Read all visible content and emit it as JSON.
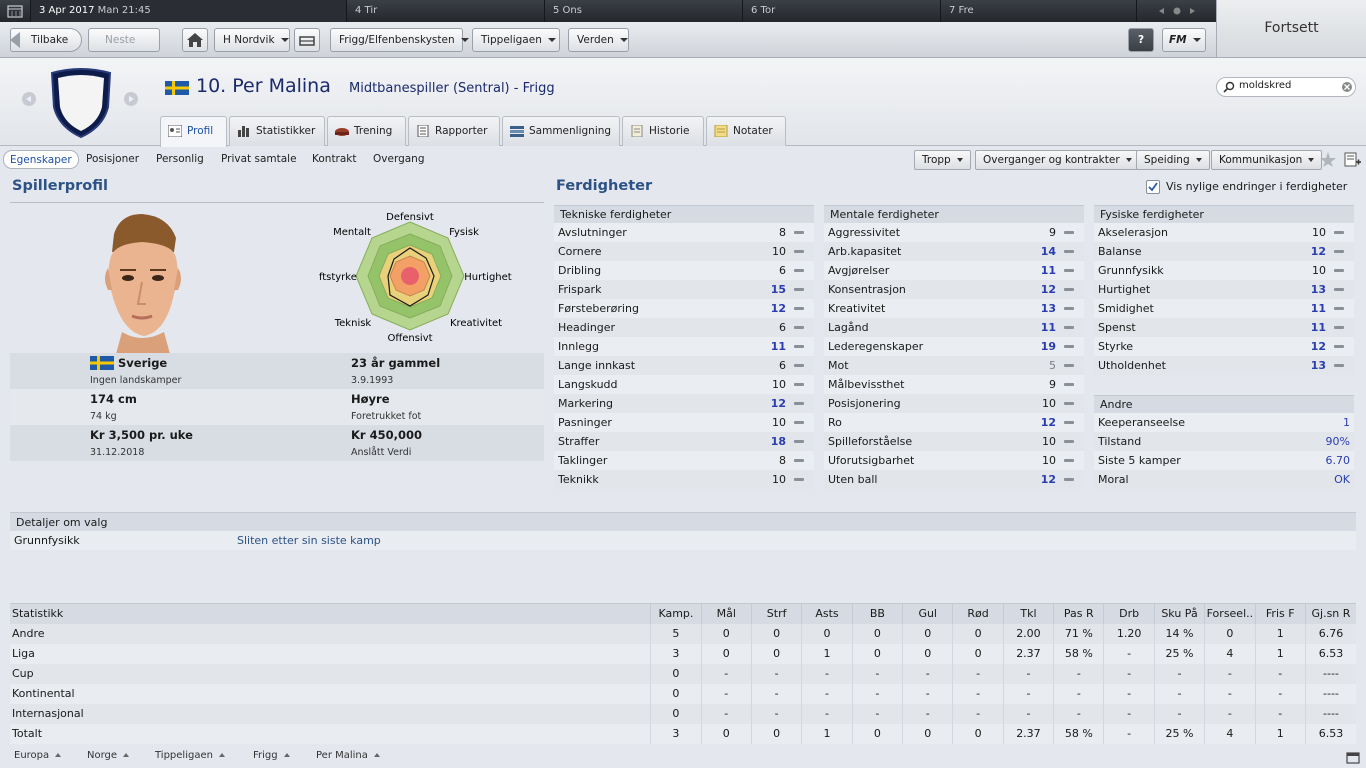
{
  "calendar": {
    "date": "3 Apr 2017",
    "time": "Man 21:45",
    "days": [
      "4 Tir",
      "5 Ons",
      "6 Tor",
      "7 Fre"
    ]
  },
  "nav": {
    "back": "Tilbake",
    "next": "Neste",
    "club": "H Nordvik",
    "competition_1": "Frigg/Elfenbenskysten",
    "competition_2": "Tippeligaen",
    "world": "Verden",
    "help": "?",
    "fm": "FM",
    "continue": "Fortsett"
  },
  "search": {
    "value": "moldskred"
  },
  "player": {
    "number_name": "10. Per Malina",
    "role": "Midtbanespiller (Sentral) - Frigg"
  },
  "tabs": [
    "Profil",
    "Statistikker",
    "Trening",
    "Rapporter",
    "Sammenligning",
    "Historie",
    "Notater"
  ],
  "subtabs": [
    "Egenskaper",
    "Posisjoner",
    "Personlig",
    "Privat samtale",
    "Kontrakt",
    "Overgang"
  ],
  "actions": [
    "Tropp",
    "Overganger og kontrakter",
    "Speiding",
    "Kommunikasjon"
  ],
  "profile": {
    "title": "Spillerprofil",
    "nation": "Sverige",
    "caps": "Ingen landskamper",
    "age": "23 år gammel",
    "dob": "3.9.1993",
    "height": "174 cm",
    "weight": "74 kg",
    "foot": "Høyre",
    "foot_label": "Foretrukket fot",
    "wage": "Kr 3,500 pr. uke",
    "contract_end": "31.12.2018",
    "value": "Kr 450,000",
    "value_label": "Anslått Verdi",
    "radar_labels": [
      "Defensivt",
      "Fysisk",
      "Hurtighet",
      "Kreativitet",
      "Offensivt",
      "Teknisk",
      "Luftstyrke",
      "Mentalt"
    ]
  },
  "skills": {
    "title": "Ferdigheter",
    "show_changes": "Vis nylige endringer i ferdigheter",
    "technical": {
      "header": "Tekniske ferdigheter",
      "rows": [
        [
          "Avslutninger",
          "8"
        ],
        [
          "Cornere",
          "10"
        ],
        [
          "Dribling",
          "6"
        ],
        [
          "Frispark",
          "15"
        ],
        [
          "Førsteberøring",
          "12"
        ],
        [
          "Headinger",
          "6"
        ],
        [
          "Innlegg",
          "11"
        ],
        [
          "Lange innkast",
          "6"
        ],
        [
          "Langskudd",
          "10"
        ],
        [
          "Markering",
          "12"
        ],
        [
          "Pasninger",
          "10"
        ],
        [
          "Straffer",
          "18"
        ],
        [
          "Taklinger",
          "8"
        ],
        [
          "Teknikk",
          "10"
        ]
      ]
    },
    "mental": {
      "header": "Mentale ferdigheter",
      "rows": [
        [
          "Aggressivitet",
          "9"
        ],
        [
          "Arb.kapasitet",
          "14"
        ],
        [
          "Avgjørelser",
          "11"
        ],
        [
          "Konsentrasjon",
          "12"
        ],
        [
          "Kreativitet",
          "13"
        ],
        [
          "Lagånd",
          "11"
        ],
        [
          "Lederegenskaper",
          "19"
        ],
        [
          "Mot",
          "5"
        ],
        [
          "Målbevissthet",
          "9"
        ],
        [
          "Posisjonering",
          "10"
        ],
        [
          "Ro",
          "12"
        ],
        [
          "Spilleforståelse",
          "10"
        ],
        [
          "Uforutsigbarhet",
          "10"
        ],
        [
          "Uten ball",
          "12"
        ]
      ]
    },
    "physical": {
      "header": "Fysiske ferdigheter",
      "rows": [
        [
          "Akselerasjon",
          "10"
        ],
        [
          "Balanse",
          "12"
        ],
        [
          "Grunnfysikk",
          "10"
        ],
        [
          "Hurtighet",
          "13"
        ],
        [
          "Smidighet",
          "11"
        ],
        [
          "Spenst",
          "11"
        ],
        [
          "Styrke",
          "12"
        ],
        [
          "Utholdenhet",
          "13"
        ]
      ]
    },
    "other": {
      "header": "Andre",
      "rows": [
        [
          "Keeperanseelse",
          "1"
        ],
        [
          "Tilstand",
          "90%"
        ],
        [
          "Siste 5 kamper",
          "6.70"
        ],
        [
          "Moral",
          "OK"
        ]
      ]
    }
  },
  "details": {
    "header": "Detaljer om valg",
    "label": "Grunnfysikk",
    "value": "Sliten etter sin siste kamp"
  },
  "stats": {
    "headers": [
      "Statistikk",
      "Kamp.",
      "Mål",
      "Strf",
      "Asts",
      "BB",
      "Gul",
      "Rød",
      "Tkl",
      "Pas R",
      "Drb",
      "Sku På",
      "Forseel..",
      "Fris F",
      "Gj.sn R"
    ],
    "rows": [
      [
        "Andre",
        "5",
        "0",
        "0",
        "0",
        "0",
        "0",
        "0",
        "2.00",
        "71 %",
        "1.20",
        "14 %",
        "0",
        "1",
        "6.76"
      ],
      [
        "Liga",
        "3",
        "0",
        "0",
        "1",
        "0",
        "0",
        "0",
        "2.37",
        "58 %",
        "-",
        "25 %",
        "4",
        "1",
        "6.53"
      ],
      [
        "Cup",
        "0",
        "-",
        "-",
        "-",
        "-",
        "-",
        "-",
        "-",
        "-",
        "-",
        "-",
        "-",
        "-",
        "----"
      ],
      [
        "Kontinental",
        "0",
        "-",
        "-",
        "-",
        "-",
        "-",
        "-",
        "-",
        "-",
        "-",
        "-",
        "-",
        "-",
        "----"
      ],
      [
        "Internasjonal",
        "0",
        "-",
        "-",
        "-",
        "-",
        "-",
        "-",
        "-",
        "-",
        "-",
        "-",
        "-",
        "-",
        "----"
      ],
      [
        "Totalt",
        "3",
        "0",
        "0",
        "1",
        "0",
        "0",
        "0",
        "2.37",
        "58 %",
        "-",
        "25 %",
        "4",
        "1",
        "6.53"
      ]
    ]
  },
  "breadcrumbs": [
    "Europa",
    "Norge",
    "Tippeligaen",
    "Frigg",
    "Per Malina"
  ]
}
